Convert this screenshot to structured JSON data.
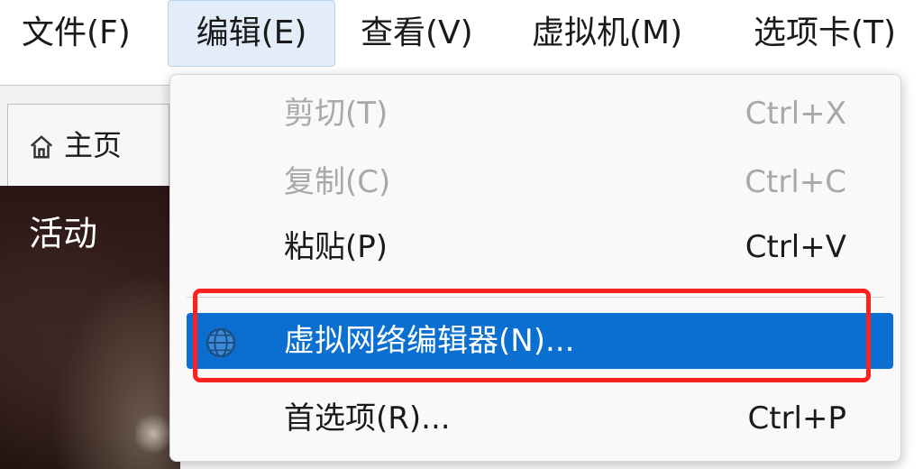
{
  "menubar": {
    "file": "文件(F)",
    "edit": "编辑(E)",
    "view": "查看(V)",
    "vm": "虚拟机(M)",
    "tabs": "选项卡(T)"
  },
  "left_panel": {
    "home_tab": "主页",
    "activity_label": "活动"
  },
  "edit_menu": {
    "cut": {
      "label": "剪切(T)",
      "shortcut": "Ctrl+X"
    },
    "copy": {
      "label": "复制(C)",
      "shortcut": "Ctrl+C"
    },
    "paste": {
      "label": "粘贴(P)",
      "shortcut": "Ctrl+V"
    },
    "virtual_network_editor": {
      "label": "虚拟网络编辑器(N)...",
      "icon": "globe-icon"
    },
    "preferences": {
      "label": "首选项(R)...",
      "shortcut": "Ctrl+P"
    }
  },
  "colors": {
    "highlight": "#0a6fd1",
    "annotation_box": "#ff2020",
    "active_menu_bg": "#e3edf9"
  }
}
